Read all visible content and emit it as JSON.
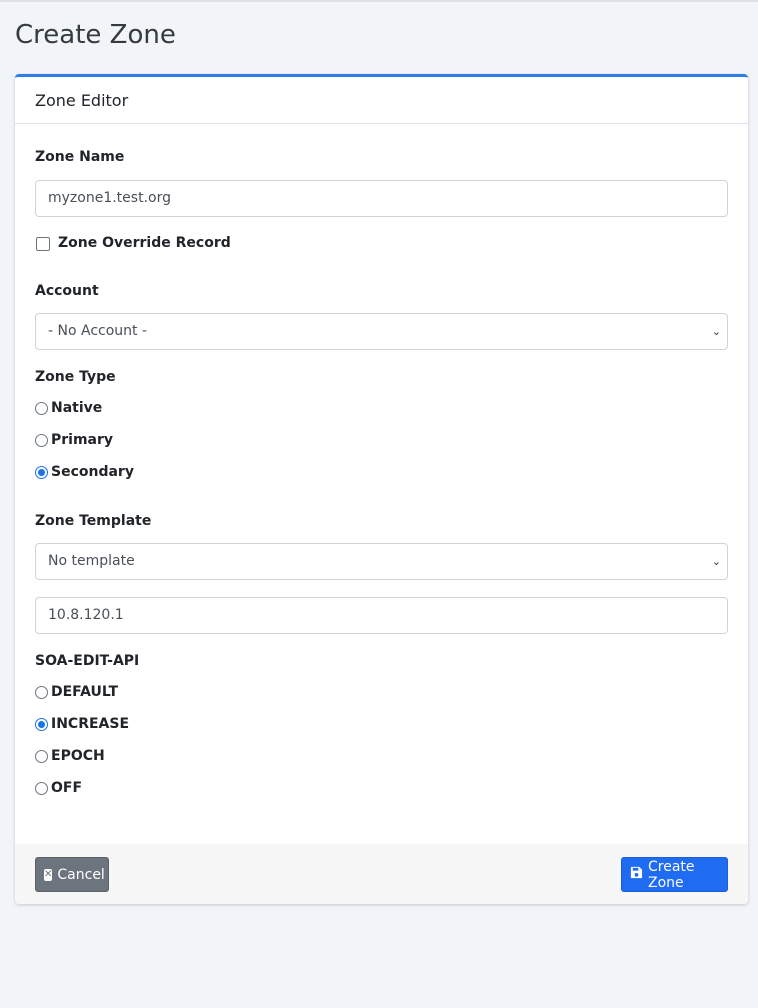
{
  "page": {
    "title": "Create Zone"
  },
  "card": {
    "header": "Zone Editor"
  },
  "zone_name": {
    "label": "Zone Name",
    "value": "myzone1.test.org"
  },
  "override": {
    "label": "Zone Override Record",
    "checked": false
  },
  "account": {
    "label": "Account",
    "selected": "- No Account -"
  },
  "zone_type": {
    "label": "Zone Type",
    "options": [
      {
        "label": "Native",
        "checked": false
      },
      {
        "label": "Primary",
        "checked": false
      },
      {
        "label": "Secondary",
        "checked": true
      }
    ]
  },
  "zone_template": {
    "label": "Zone Template",
    "selected": "No template"
  },
  "master_ip": {
    "value": "10.8.120.1"
  },
  "soa_edit_api": {
    "label": "SOA-EDIT-API",
    "options": [
      {
        "label": "DEFAULT",
        "checked": false
      },
      {
        "label": "INCREASE",
        "checked": true
      },
      {
        "label": "EPOCH",
        "checked": false
      },
      {
        "label": "OFF",
        "checked": false
      }
    ]
  },
  "footer": {
    "cancel_label": "Cancel",
    "create_label": "Create Zone"
  },
  "colors": {
    "accent": "#1f6cf2",
    "card_top": "#2f7ee8",
    "secondary": "#6c757d"
  }
}
